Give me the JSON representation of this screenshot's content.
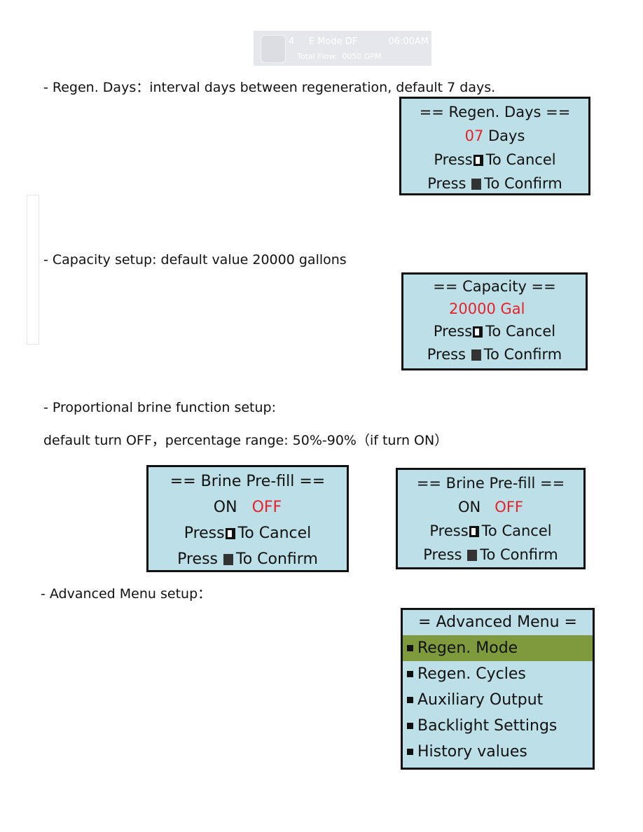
{
  "header_display": {
    "icon": "device-icon",
    "indicator": "4",
    "mode": "E Mode DF",
    "time": "06:00AM",
    "flow_label": "Total Flow:",
    "flow_value": "0050 GPM"
  },
  "sections": {
    "regen_days": {
      "description": "- Regen. Days：interval days between regeneration, default 7 days.",
      "screen": {
        "title": "== Regen. Days ==",
        "value": "07",
        "unit": "Days",
        "cancel_prefix": "Press",
        "cancel_suffix": "To Cancel",
        "confirm_prefix": "Press",
        "confirm_suffix": "To Confirm"
      }
    },
    "capacity": {
      "description": "- Capacity setup: default value 20000 gallons",
      "screen": {
        "title": "== Capacity ==",
        "value": "20000 Gal",
        "cancel_prefix": "Press",
        "cancel_suffix": "To Cancel",
        "confirm_prefix": "Press",
        "confirm_suffix": "To Confirm"
      }
    },
    "brine": {
      "description": "-  Proportional brine function setup:",
      "description2": "default turn OFF，percentage range: 50%-90%（if turn ON）",
      "screens": [
        {
          "title": "== Brine Pre-fill ==",
          "on": "ON",
          "off": "OFF",
          "cancel_prefix": "Press",
          "cancel_suffix": "To Cancel",
          "confirm_prefix": "Press",
          "confirm_suffix": "To Confirm"
        },
        {
          "title": "== Brine Pre-fill ==",
          "on": "ON",
          "off": "OFF",
          "cancel_prefix": "Press",
          "cancel_suffix": "To Cancel",
          "confirm_prefix": "Press",
          "confirm_suffix": "To Confirm"
        }
      ]
    },
    "advanced": {
      "description": "- Advanced Menu setup：",
      "screen": {
        "title": "= Advanced Menu =",
        "items": [
          "Regen. Mode",
          "Regen. Cycles",
          "Auxiliary Output",
          "Backlight Settings",
          "History values"
        ],
        "selected_index": 0
      }
    }
  },
  "colors": {
    "screen_bg": "#bde0e8",
    "highlight": "#7e9a3c",
    "value_red": "#e8202a"
  }
}
